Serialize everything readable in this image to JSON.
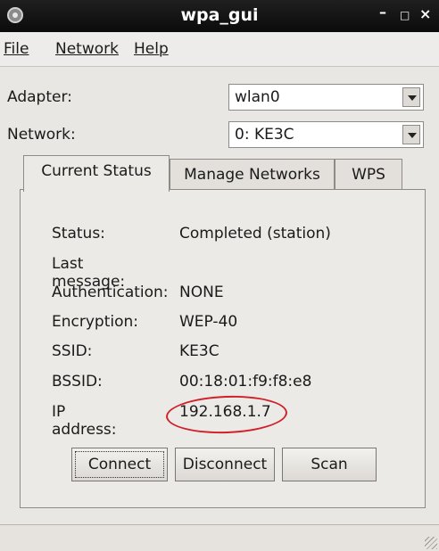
{
  "window": {
    "title": "wpa_gui"
  },
  "menu": {
    "file": "File",
    "network": "Network",
    "help": "Help"
  },
  "adapter": {
    "label": "Adapter:",
    "value": "wlan0"
  },
  "network": {
    "label": "Network:",
    "value": "0: KE3C"
  },
  "tabs": [
    {
      "label": "Current Status",
      "active": true
    },
    {
      "label": "Manage Networks",
      "active": false
    },
    {
      "label": "WPS",
      "active": false
    }
  ],
  "status": {
    "status_label": "Status:",
    "status_value": "Completed (station)",
    "last_message_label": "Last message:",
    "last_message_value": "",
    "auth_label": "Authentication:",
    "auth_value": "NONE",
    "enc_label": "Encryption:",
    "enc_value": "WEP-40",
    "ssid_label": "SSID:",
    "ssid_value": "KE3C",
    "bssid_label": "BSSID:",
    "bssid_value": "00:18:01:f9:f8:e8",
    "ip_label": "IP address:",
    "ip_value": "192.168.1.7"
  },
  "buttons": {
    "connect": "Connect",
    "disconnect": "Disconnect",
    "scan": "Scan"
  },
  "annotation_color": "#d0212a"
}
